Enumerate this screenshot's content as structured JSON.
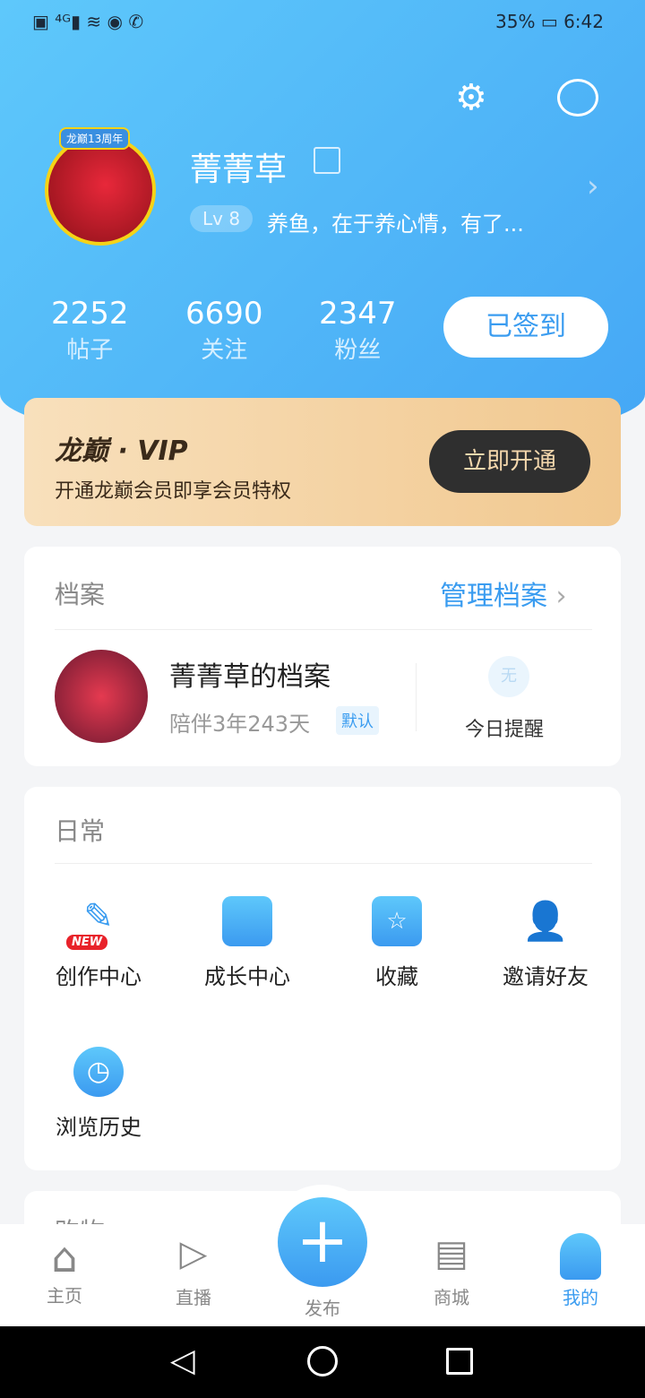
{
  "status_bar": {
    "left_icons": [
      "hd-icon",
      "4g-signal-icon",
      "wifi-icon",
      "eye-icon",
      "wechat-icon"
    ],
    "battery": "35%",
    "time": "6:42"
  },
  "profile": {
    "username": "菁菁草",
    "level": "Lv 8",
    "bio": "养鱼，在于养心情，有了...",
    "avatar_badge": "龙巅13周年",
    "stats": [
      {
        "value": "2252",
        "label": "帖子"
      },
      {
        "value": "6690",
        "label": "关注"
      },
      {
        "value": "2347",
        "label": "粉丝"
      }
    ],
    "checkin_label": "已签到"
  },
  "vip": {
    "title": "龙巅 · VIP",
    "subtitle": "开通龙巅会员即享会员特权",
    "button": "立即开通"
  },
  "archive": {
    "title": "档案",
    "manage": "管理档案",
    "name": "菁菁草的档案",
    "duration": "陪伴3年243天",
    "tag": "默认",
    "reminder_badge": "无",
    "reminder_label": "今日提醒"
  },
  "daily": {
    "title": "日常",
    "items": [
      {
        "label": "创作中心",
        "badge": "NEW",
        "icon": "pen-icon"
      },
      {
        "label": "成长中心",
        "icon": "growth-chart-icon"
      },
      {
        "label": "收藏",
        "icon": "star-folder-icon"
      },
      {
        "label": "邀请好友",
        "icon": "add-user-icon"
      },
      {
        "label": "浏览历史",
        "icon": "clock-icon"
      }
    ]
  },
  "shopping": {
    "title": "购物"
  },
  "tabbar": {
    "items": [
      "主页",
      "直播",
      "发布",
      "商城",
      "我的"
    ],
    "active": "我的"
  },
  "colors": {
    "accent": "#3a9cf0",
    "hero": "#4fb5f8",
    "vip_bg": "#f5d5a8"
  }
}
